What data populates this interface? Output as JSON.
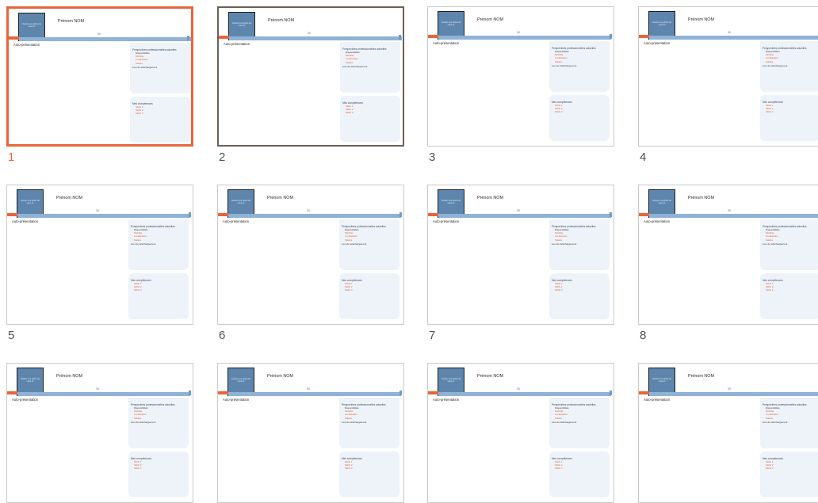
{
  "slide_template": {
    "photo_caption": "Insérer une photo de vous ici",
    "name": "Prénom NOM",
    "bar_label": "30",
    "section_title": "Auto-présentation",
    "panel1_title": "Perspectives professionnelles actuelles",
    "panel1_items": [
      "Disponibilités",
      "Mobilité",
      "Localisation",
      "Salaire"
    ],
    "panel1_note": "Lien de téléchargement",
    "panel2_title": "Mes compétences",
    "panel2_items": [
      "Skills 1",
      "Skills 2",
      "Skills 3"
    ]
  },
  "slides": [
    {
      "number": "1",
      "state": "selected"
    },
    {
      "number": "2",
      "state": "hovered"
    },
    {
      "number": "3",
      "state": "normal"
    },
    {
      "number": "4",
      "state": "normal"
    },
    {
      "number": "5",
      "state": "normal"
    },
    {
      "number": "6",
      "state": "normal"
    },
    {
      "number": "7",
      "state": "normal"
    },
    {
      "number": "8",
      "state": "normal"
    },
    {
      "number": "",
      "state": "normal"
    },
    {
      "number": "",
      "state": "normal"
    },
    {
      "number": "",
      "state": "normal"
    },
    {
      "number": "",
      "state": "normal"
    }
  ],
  "colors": {
    "accent": "#e8643a",
    "bar": "#8fb2d6",
    "photo": "#5e86ad",
    "panel": "#edf3f9"
  }
}
